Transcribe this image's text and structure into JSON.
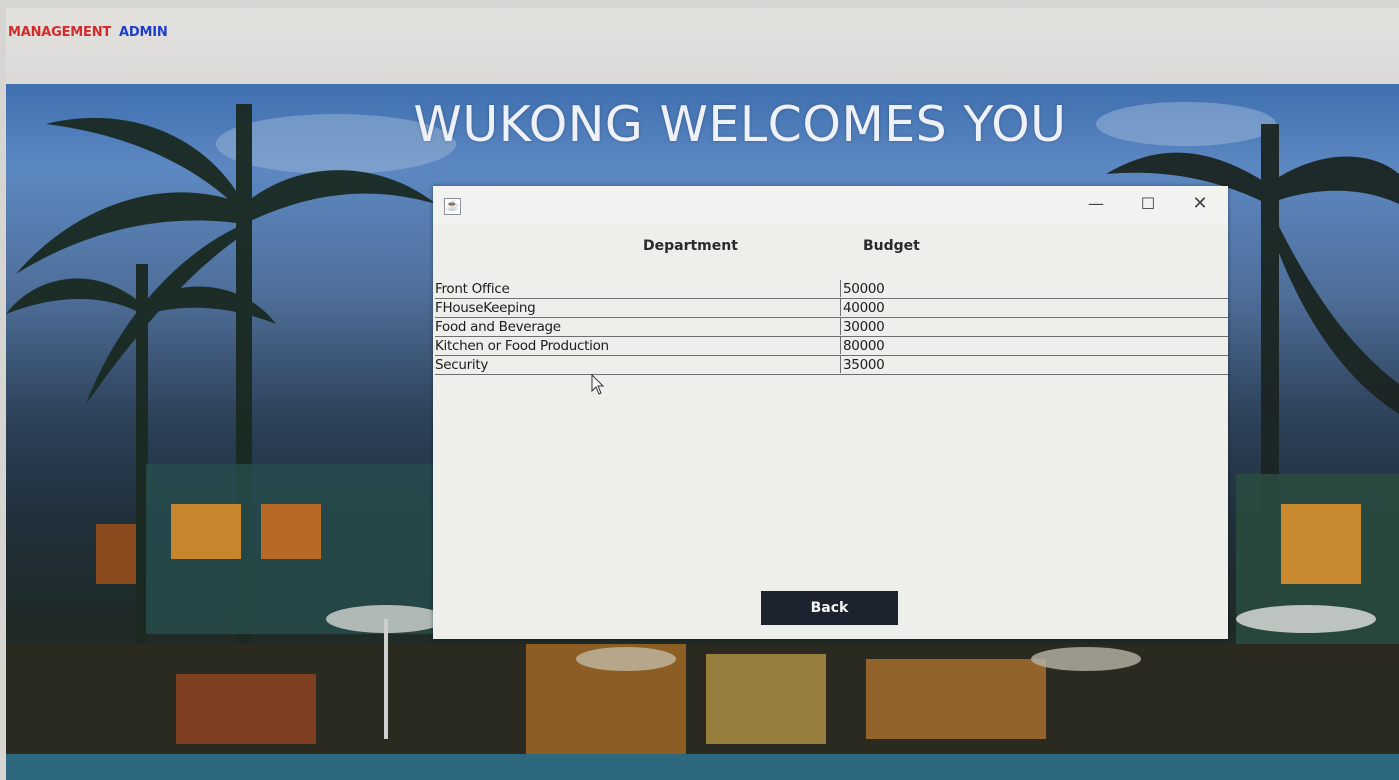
{
  "menu": {
    "items": [
      "MANAGEMENT",
      "ADMIN"
    ]
  },
  "banner": {
    "welcome_text": "WUKONG WELCOMES YOU"
  },
  "dialog": {
    "columns": [
      "Department",
      "Budget"
    ],
    "rows": [
      {
        "department": "Front Office",
        "budget": "50000"
      },
      {
        "department": "FHouseKeeping",
        "budget": "40000"
      },
      {
        "department": "Food and Beverage",
        "budget": "30000"
      },
      {
        "department": "Kitchen or Food Production",
        "budget": "80000"
      },
      {
        "department": "Security",
        "budget": "35000"
      }
    ],
    "back_label": "Back"
  },
  "colors": {
    "management": "#d42a2a",
    "admin": "#1e3ec9",
    "back_button_bg": "#1c232e"
  },
  "icons": [
    "java-app-icon",
    "minimize-icon",
    "maximize-icon",
    "close-icon",
    "mouse-cursor-icon"
  ]
}
